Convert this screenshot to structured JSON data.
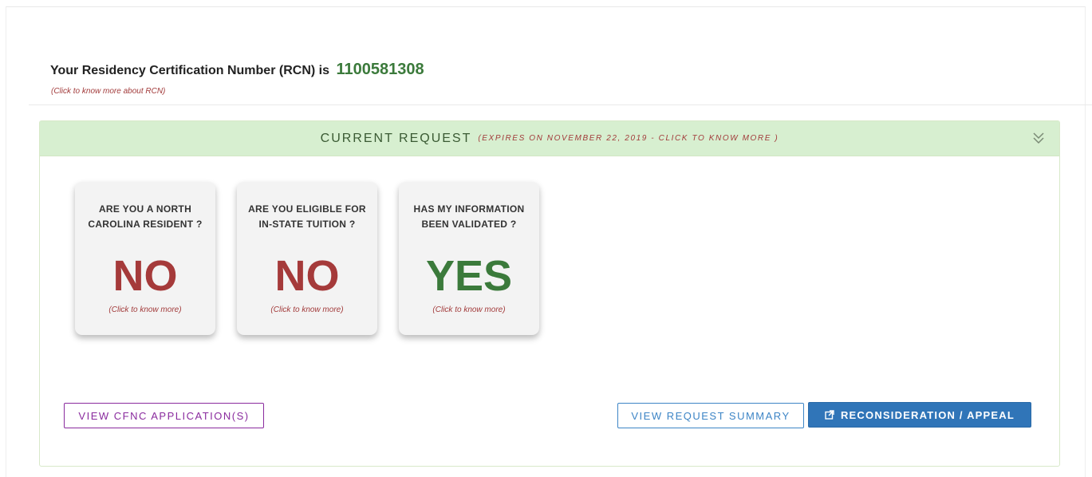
{
  "rcn": {
    "prefix": "Your Residency Certification Number (RCN) is",
    "number": "1100581308",
    "help_link": "(Click to know more about RCN)"
  },
  "panel": {
    "title": "CURRENT REQUEST",
    "expiry": "(EXPIRES ON NOVEMBER 22, 2019 - CLICK TO KNOW MORE )",
    "toggle_icon": "double-chevron-down-icon"
  },
  "cards": [
    {
      "question": "ARE YOU A NORTH CAROLINA RESIDENT ?",
      "answer": "NO",
      "help": "(Click to know more)"
    },
    {
      "question": "ARE YOU ELIGIBLE FOR IN-STATE TUITION ?",
      "answer": "NO",
      "help": "(Click to know more)"
    },
    {
      "question": "HAS MY INFORMATION BEEN VALIDATED ?",
      "answer": "YES",
      "help": "(Click to know more)"
    }
  ],
  "buttons": {
    "cfnc": "VIEW CFNC APPLICATION(S)",
    "summary": "VIEW REQUEST SUMMARY",
    "appeal": "RECONSIDERATION / APPEAL",
    "appeal_icon": "external-link-icon"
  },
  "colors": {
    "success": "#3b7a3b",
    "danger": "#a53a3a",
    "header_bg": "#d7efd0",
    "primary": "#3075b8",
    "purple": "#8a2b9e"
  }
}
